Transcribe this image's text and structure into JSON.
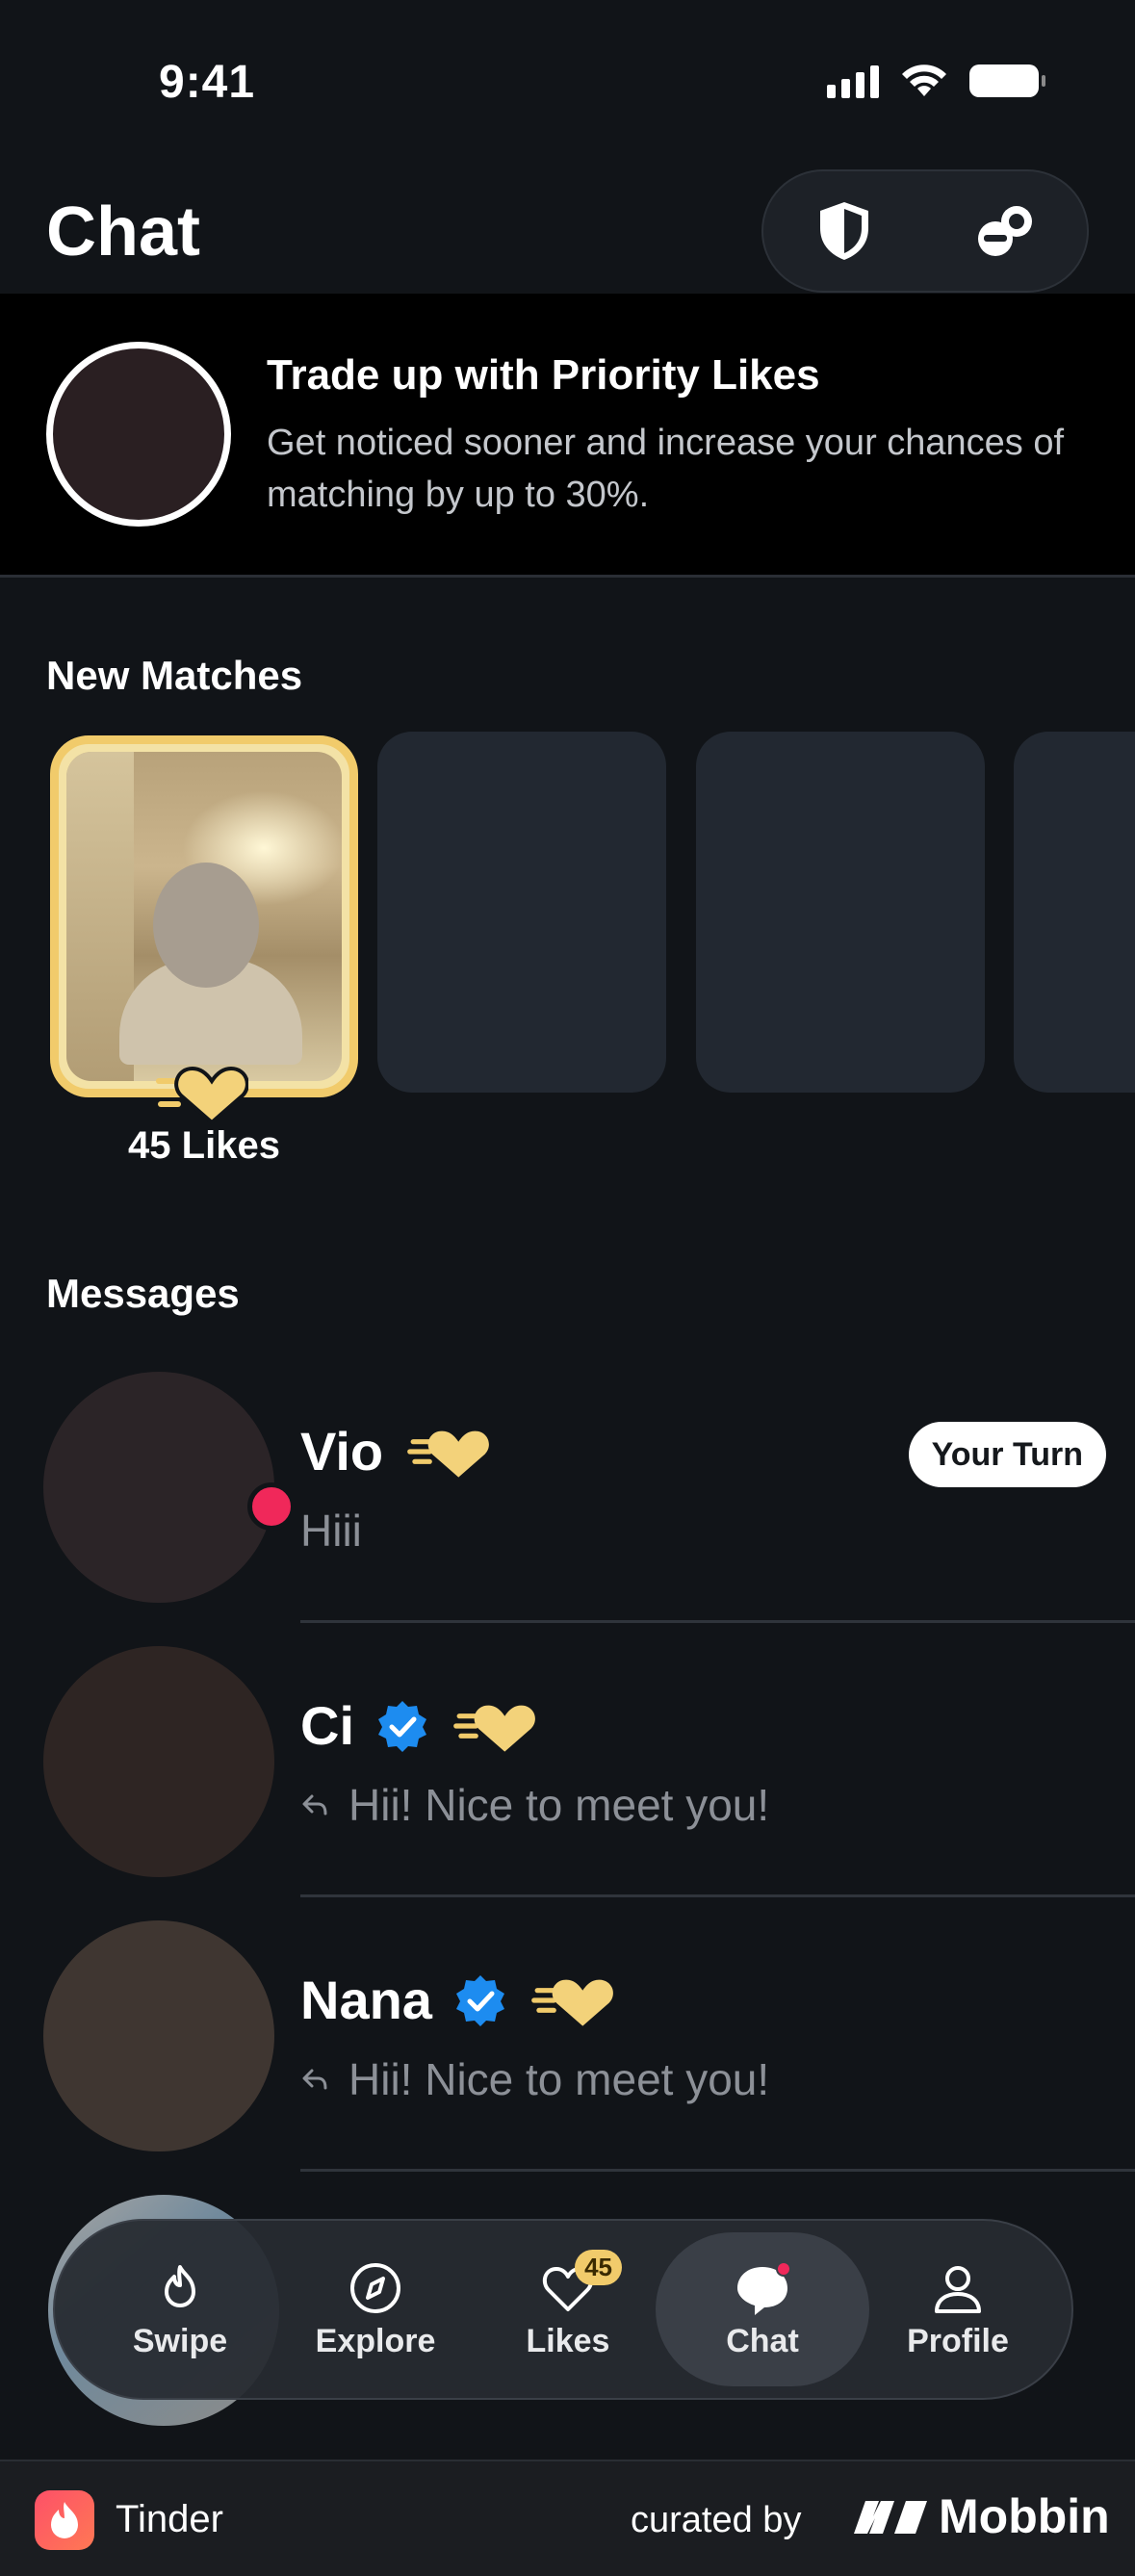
{
  "status_bar": {
    "time": "9:41"
  },
  "header": {
    "title": "Chat"
  },
  "promo": {
    "title": "Trade up with Priority Likes",
    "body": "Get noticed sooner and increase your chances of matching by up to 30%."
  },
  "new_matches": {
    "title": "New Matches",
    "likes_label": "45 Likes"
  },
  "messages": {
    "title": "Messages",
    "items": [
      {
        "name": "Vio",
        "preview": "Hiii",
        "badge": "Your Turn",
        "verified": false,
        "online": true,
        "replied": false,
        "avatar_color": "#2b2427"
      },
      {
        "name": "Ci",
        "preview": "Hii! Nice to meet you!",
        "badge": "",
        "verified": true,
        "online": false,
        "replied": true,
        "avatar_color": "#2e2523"
      },
      {
        "name": "Nana",
        "preview": "Hii! Nice to meet you!",
        "badge": "",
        "verified": true,
        "online": false,
        "replied": true,
        "avatar_color": "#3f3631"
      }
    ]
  },
  "bottom_nav": {
    "items": [
      {
        "label": "Swipe",
        "icon": "swipe-icon"
      },
      {
        "label": "Explore",
        "icon": "compass-icon"
      },
      {
        "label": "Likes",
        "icon": "heart-icon",
        "badge": "45"
      },
      {
        "label": "Chat",
        "icon": "chat-bubble-icon",
        "active": true
      },
      {
        "label": "Profile",
        "icon": "person-icon"
      }
    ]
  },
  "footer": {
    "app_name": "Tinder",
    "curated_by": "curated by",
    "brand": "Mobbin"
  },
  "colors": {
    "background": "#111418",
    "accent_gold": "#f1cb6b",
    "online_red": "#f0285a",
    "verified_blue": "#1d8cf0"
  }
}
